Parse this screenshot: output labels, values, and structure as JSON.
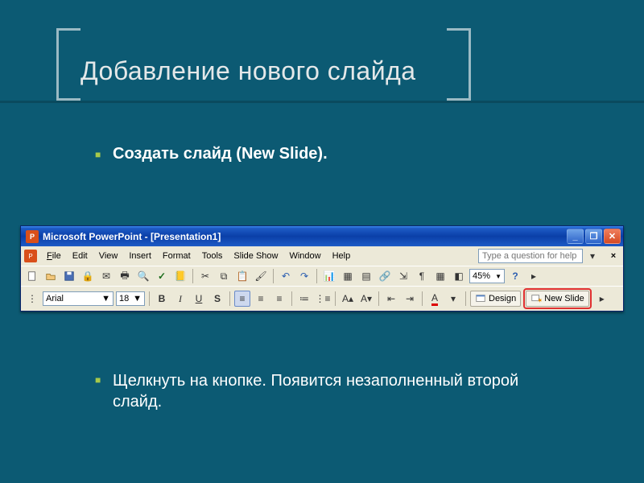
{
  "slide": {
    "title": "Добавление нового слайда",
    "bullet1": "Создать слайд (New Slide).",
    "bullet2": "Щелкнуть на кнопке. Появится незаполненный второй слайд."
  },
  "ppwin": {
    "title": "Microsoft PowerPoint - [Presentation1]",
    "help_placeholder": "Type a question for help",
    "menu": {
      "file": "File",
      "edit": "Edit",
      "view": "View",
      "insert": "Insert",
      "format": "Format",
      "tools": "Tools",
      "slideshow": "Slide Show",
      "window": "Window",
      "help": "Help"
    },
    "zoom": "45%",
    "font_name": "Arial",
    "font_size": "18",
    "design_label": "Design",
    "new_slide_label": "New Slide"
  }
}
